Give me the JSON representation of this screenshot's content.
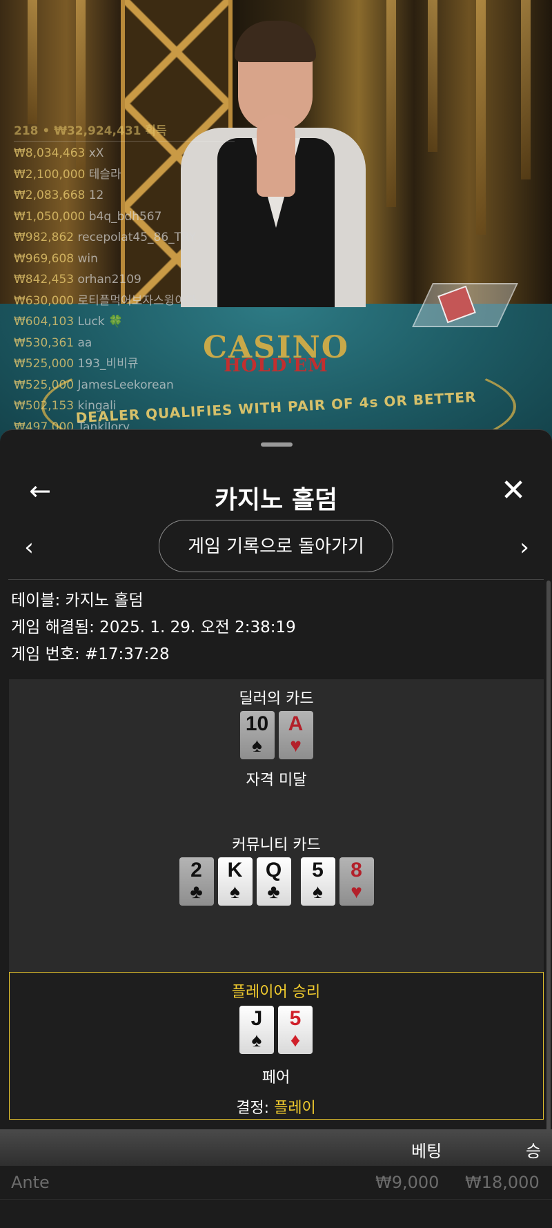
{
  "stream": {
    "felt_title": "CASINO",
    "felt_subtitle": "HOLD'EM",
    "felt_rule": "DEALER QUALIFIES WITH PAIR OF 4s OR BETTER",
    "winners_summary": "218 • ₩32,924,431 획득",
    "winners": [
      {
        "amount": "₩8,034,463",
        "name": "xX"
      },
      {
        "amount": "₩2,100,000",
        "name": "테슬라"
      },
      {
        "amount": "₩2,083,668",
        "name": "12"
      },
      {
        "amount": "₩1,050,000",
        "name": "b4q_bdh567"
      },
      {
        "amount": "₩982,862",
        "name": "recepolat45_86_TRY"
      },
      {
        "amount": "₩969,608",
        "name": "win"
      },
      {
        "amount": "₩842,453",
        "name": "orhan2109"
      },
      {
        "amount": "₩630,000",
        "name": "로티플먹어보자스윙이다"
      },
      {
        "amount": "₩604,103",
        "name": "Luck 🍀"
      },
      {
        "amount": "₩530,361",
        "name": "aa"
      },
      {
        "amount": "₩525,000",
        "name": "193_비비큐"
      },
      {
        "amount": "₩525,000",
        "name": "JamesLeekorean"
      },
      {
        "amount": "₩502,153",
        "name": "kingali"
      },
      {
        "amount": "₩497,000",
        "name": "Tankllory"
      }
    ]
  },
  "header": {
    "title": "카지노 홀덤",
    "back_icon": "←",
    "close_icon": "✕"
  },
  "nav": {
    "prev_icon": "‹",
    "next_icon": "›",
    "history_button": "게임 기록으로 돌아가기"
  },
  "info": {
    "table": "테이블: 카지노 홀덤",
    "resolved": "게임 해결됨: 2025. 1. 29. 오전 2:38:19",
    "game_number": "게임 번호: #17:37:28"
  },
  "dealer": {
    "label": "딜러의 카드",
    "cards": [
      {
        "rank": "10",
        "suit": "♠",
        "color": "black",
        "highlight": false
      },
      {
        "rank": "A",
        "suit": "♥",
        "color": "red",
        "highlight": false
      }
    ],
    "result": "자격 미달"
  },
  "community": {
    "label": "커뮤니티 카드",
    "cards": [
      {
        "rank": "2",
        "suit": "♣",
        "color": "black",
        "highlight": false
      },
      {
        "rank": "K",
        "suit": "♠",
        "color": "black",
        "highlight": true
      },
      {
        "rank": "Q",
        "suit": "♣",
        "color": "black",
        "highlight": true
      },
      {
        "rank": "5",
        "suit": "♠",
        "color": "black",
        "highlight": true
      },
      {
        "rank": "8",
        "suit": "♥",
        "color": "red",
        "highlight": false
      }
    ]
  },
  "player": {
    "result": "플레이어 승리",
    "cards": [
      {
        "rank": "J",
        "suit": "♠",
        "color": "black",
        "highlight": true
      },
      {
        "rank": "5",
        "suit": "♦",
        "color": "red",
        "highlight": true
      }
    ],
    "hand": "페어",
    "decision_label": "결정: ",
    "decision_value": "플레이"
  },
  "bets": {
    "col_bet": "베팅",
    "col_win": "승",
    "rows": [
      {
        "name": "Ante",
        "bet": "₩9,000",
        "payout": "₩18,000"
      }
    ]
  },
  "colors": {
    "accent": "#f2cc2e",
    "background": "#1c1c1c",
    "panel": "#2b2b2b",
    "red_suit": "#d0202a"
  }
}
